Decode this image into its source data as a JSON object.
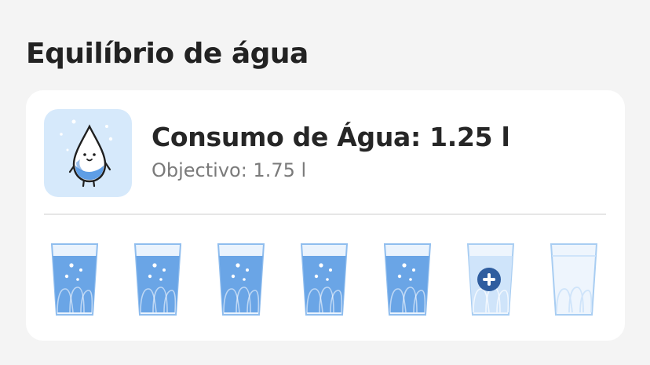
{
  "section": {
    "title": "Equilíbrio de água"
  },
  "summary": {
    "intake_label": "Consumo de Água: 1.25 l",
    "goal_label": "Objectivo: 1.75 l",
    "mascot_icon": "water-drop-mascot-icon"
  },
  "glasses": [
    {
      "state": "filled",
      "icon": "full-glass-icon"
    },
    {
      "state": "filled",
      "icon": "full-glass-icon"
    },
    {
      "state": "filled",
      "icon": "full-glass-icon"
    },
    {
      "state": "filled",
      "icon": "full-glass-icon"
    },
    {
      "state": "filled",
      "icon": "full-glass-icon"
    },
    {
      "state": "add",
      "icon": "add-icon"
    },
    {
      "state": "empty",
      "icon": "empty-glass-icon"
    }
  ],
  "colors": {
    "water": "#6aa5e6",
    "glass_outline": "#8fbdee",
    "add_button": "#2f5d9f",
    "avatar_bg": "#d6e9fb"
  }
}
